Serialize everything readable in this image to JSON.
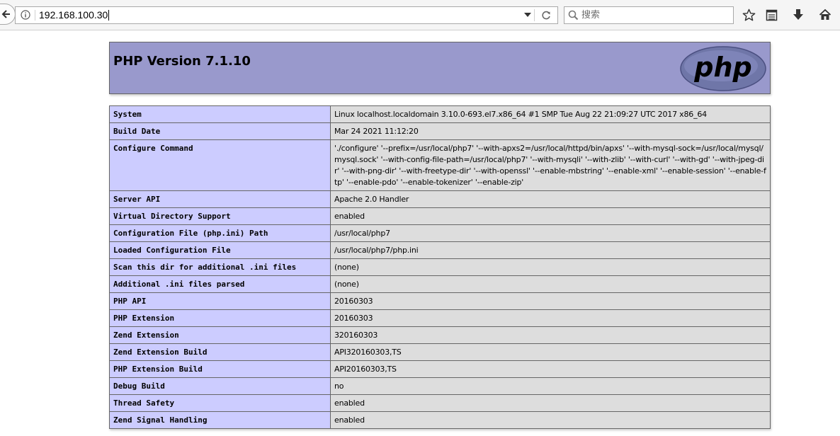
{
  "browser": {
    "url": "192.168.100.30",
    "search_placeholder": "搜索"
  },
  "php": {
    "version_title": "PHP Version 7.1.10",
    "logo_text": "php"
  },
  "info_rows": [
    {
      "label": "System",
      "value": "Linux localhost.localdomain 3.10.0-693.el7.x86_64 #1 SMP Tue Aug 22 21:09:27 UTC 2017 x86_64"
    },
    {
      "label": "Build Date",
      "value": "Mar 24 2021 11:12:20"
    },
    {
      "label": "Configure Command",
      "value": "'./configure' '--prefix=/usr/local/php7' '--with-apxs2=/usr/local/httpd/bin/apxs' '--with-mysql-sock=/usr/local/mysql/mysql.sock' '--with-config-file-path=/usr/local/php7' '--with-mysqli' '--with-zlib' '--with-curl' '--with-gd' '--with-jpeg-dir' '--with-png-dir' '--with-freetype-dir' '--with-openssl' '--enable-mbstring' '--enable-xml' '--enable-session' '--enable-ftp' '--enable-pdo' '--enable-tokenizer' '--enable-zip'"
    },
    {
      "label": "Server API",
      "value": "Apache 2.0 Handler"
    },
    {
      "label": "Virtual Directory Support",
      "value": "enabled"
    },
    {
      "label": "Configuration File (php.ini) Path",
      "value": "/usr/local/php7"
    },
    {
      "label": "Loaded Configuration File",
      "value": "/usr/local/php7/php.ini"
    },
    {
      "label": "Scan this dir for additional .ini files",
      "value": "(none)"
    },
    {
      "label": "Additional .ini files parsed",
      "value": "(none)"
    },
    {
      "label": "PHP API",
      "value": "20160303"
    },
    {
      "label": "PHP Extension",
      "value": "20160303"
    },
    {
      "label": "Zend Extension",
      "value": "320160303"
    },
    {
      "label": "Zend Extension Build",
      "value": "API320160303,TS"
    },
    {
      "label": "PHP Extension Build",
      "value": "API20160303,TS"
    },
    {
      "label": "Debug Build",
      "value": "no"
    },
    {
      "label": "Thread Safety",
      "value": "enabled"
    },
    {
      "label": "Zend Signal Handling",
      "value": "enabled"
    }
  ],
  "colors": {
    "header_bg": "#9999cc",
    "label_bg": "#ccccff",
    "value_bg": "#dddddd",
    "border": "#666666"
  }
}
